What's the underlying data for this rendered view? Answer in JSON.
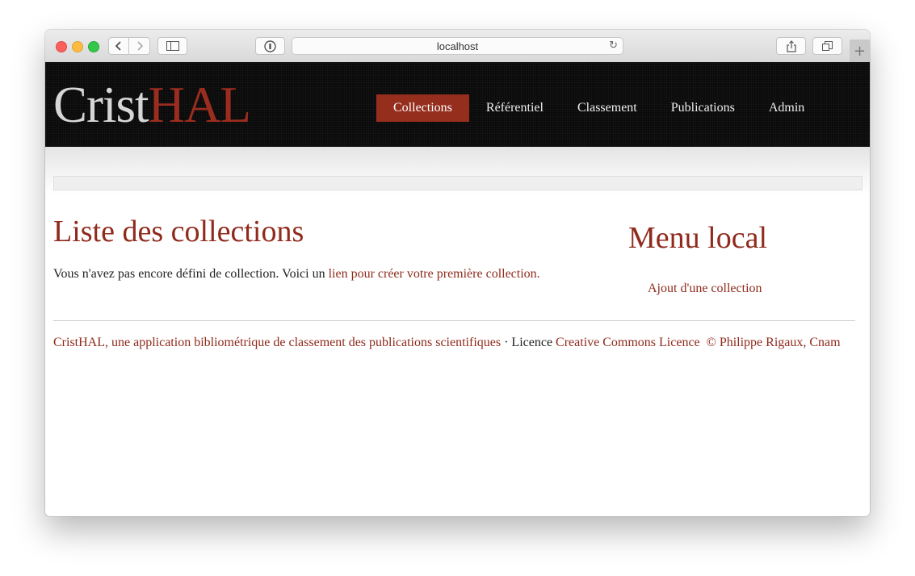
{
  "browser": {
    "url": "localhost",
    "back_icon": "chevron-left-icon",
    "forward_icon": "chevron-right-icon",
    "sidebar_icon": "sidebar-icon",
    "privacy_icon": "password-icon",
    "reload_icon": "reload-icon",
    "share_icon": "share-icon",
    "tabs_icon": "tabs-icon",
    "new_tab_label": "+"
  },
  "site": {
    "logo_part1": "Crist",
    "logo_part2": "HAL",
    "nav": [
      {
        "label": "Collections",
        "active": true
      },
      {
        "label": "Référentiel",
        "active": false
      },
      {
        "label": "Classement",
        "active": false
      },
      {
        "label": "Publications",
        "active": false
      },
      {
        "label": "Admin",
        "active": false
      }
    ]
  },
  "main": {
    "title": "Liste des collections",
    "intro_text": "Vous n'avez pas encore défini de collection. Voici un ",
    "intro_link": "lien pour créer votre première collection."
  },
  "side_menu": {
    "title": "Menu local",
    "link": "Ajout d'une collection"
  },
  "footer": {
    "app_link": "CristHAL, une application bibliométrique de classement des publications scientifiques",
    "separator": " · Licence ",
    "license_link": "Creative Commons Licence",
    "copyright": "© Philippe Rigaux, Cnam"
  },
  "colors": {
    "accent": "#962e1e",
    "header_bg": "#0a0a0a"
  }
}
